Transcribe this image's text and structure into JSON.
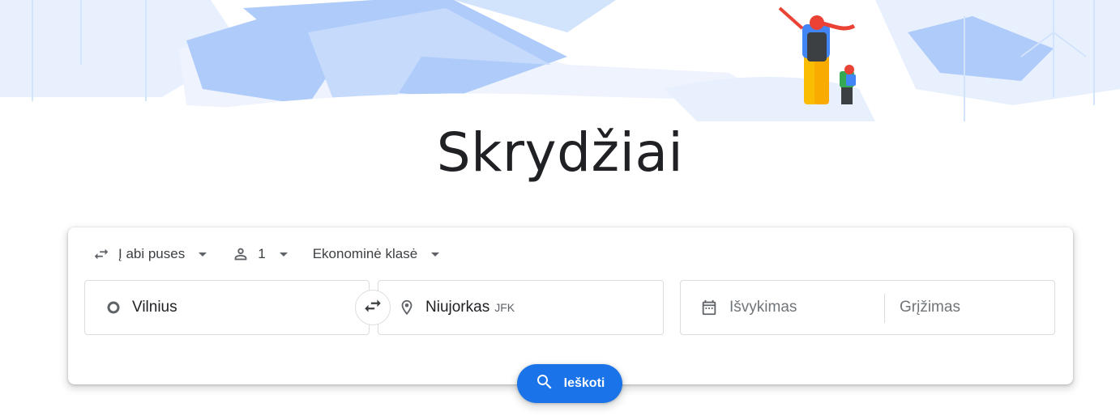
{
  "page": {
    "title": "Skrydžiai"
  },
  "search": {
    "trip_type": "Į abi puses",
    "passengers": "1",
    "cabin_class": "Ekonominė klasė",
    "origin": "Vilnius",
    "destination": "Niujorkas",
    "destination_code": "JFK",
    "departure_placeholder": "Išvykimas",
    "return_placeholder": "Grįžimas",
    "search_label": "Ieškoti"
  },
  "icons": {
    "trip_type": "swap-horiz-icon",
    "passengers": "person-icon",
    "dropdown": "caret-down-icon",
    "origin": "circle-icon",
    "swap": "swap-icon",
    "destination": "location-pin-icon",
    "date": "calendar-icon",
    "search": "search-icon"
  },
  "colors": {
    "accent": "#1a73e8",
    "mountain": "#aecbfa",
    "mountain_light": "#e8f0fe",
    "text": "#202124",
    "muted": "#70757a"
  }
}
